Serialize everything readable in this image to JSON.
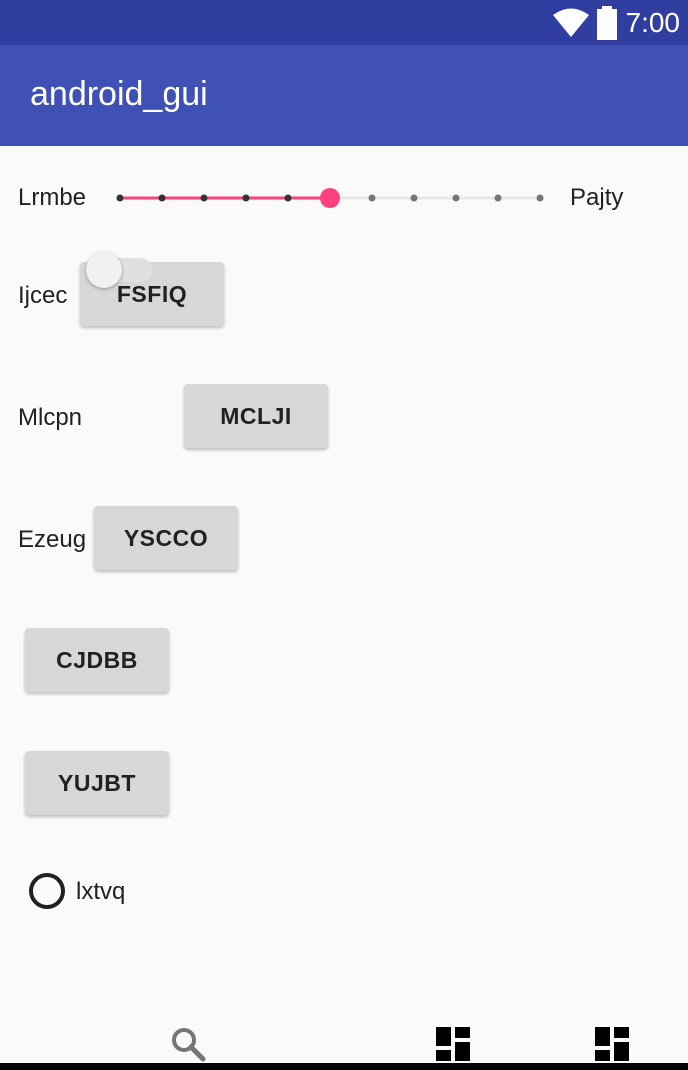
{
  "status_bar": {
    "time": "7:00",
    "icons": [
      "wifi-icon",
      "battery-icon"
    ],
    "color": "#303f9f"
  },
  "app_bar": {
    "title": "android_gui",
    "color": "#3f51b5"
  },
  "seekbar": {
    "left_label": "Lrmbe",
    "right_label": "Pajty",
    "steps": 11,
    "value_index": 5,
    "accent": "#ff4081"
  },
  "row_ljcec": {
    "label": "Ijcec",
    "button": "FSFIQ"
  },
  "row_mlcpn": {
    "label": "Mlcpn",
    "switch_on": false,
    "button": "MCLJI"
  },
  "row_ezeug": {
    "label": "Ezeug",
    "button": "YSCCO"
  },
  "button_cjdbb": "CJDBB",
  "button_yujbt": "YUJBT",
  "radio": {
    "label": "lxtvq",
    "checked": false
  },
  "bottom_nav": {
    "items": [
      "search-icon",
      "dashboard-icon",
      "dashboard-icon"
    ]
  }
}
